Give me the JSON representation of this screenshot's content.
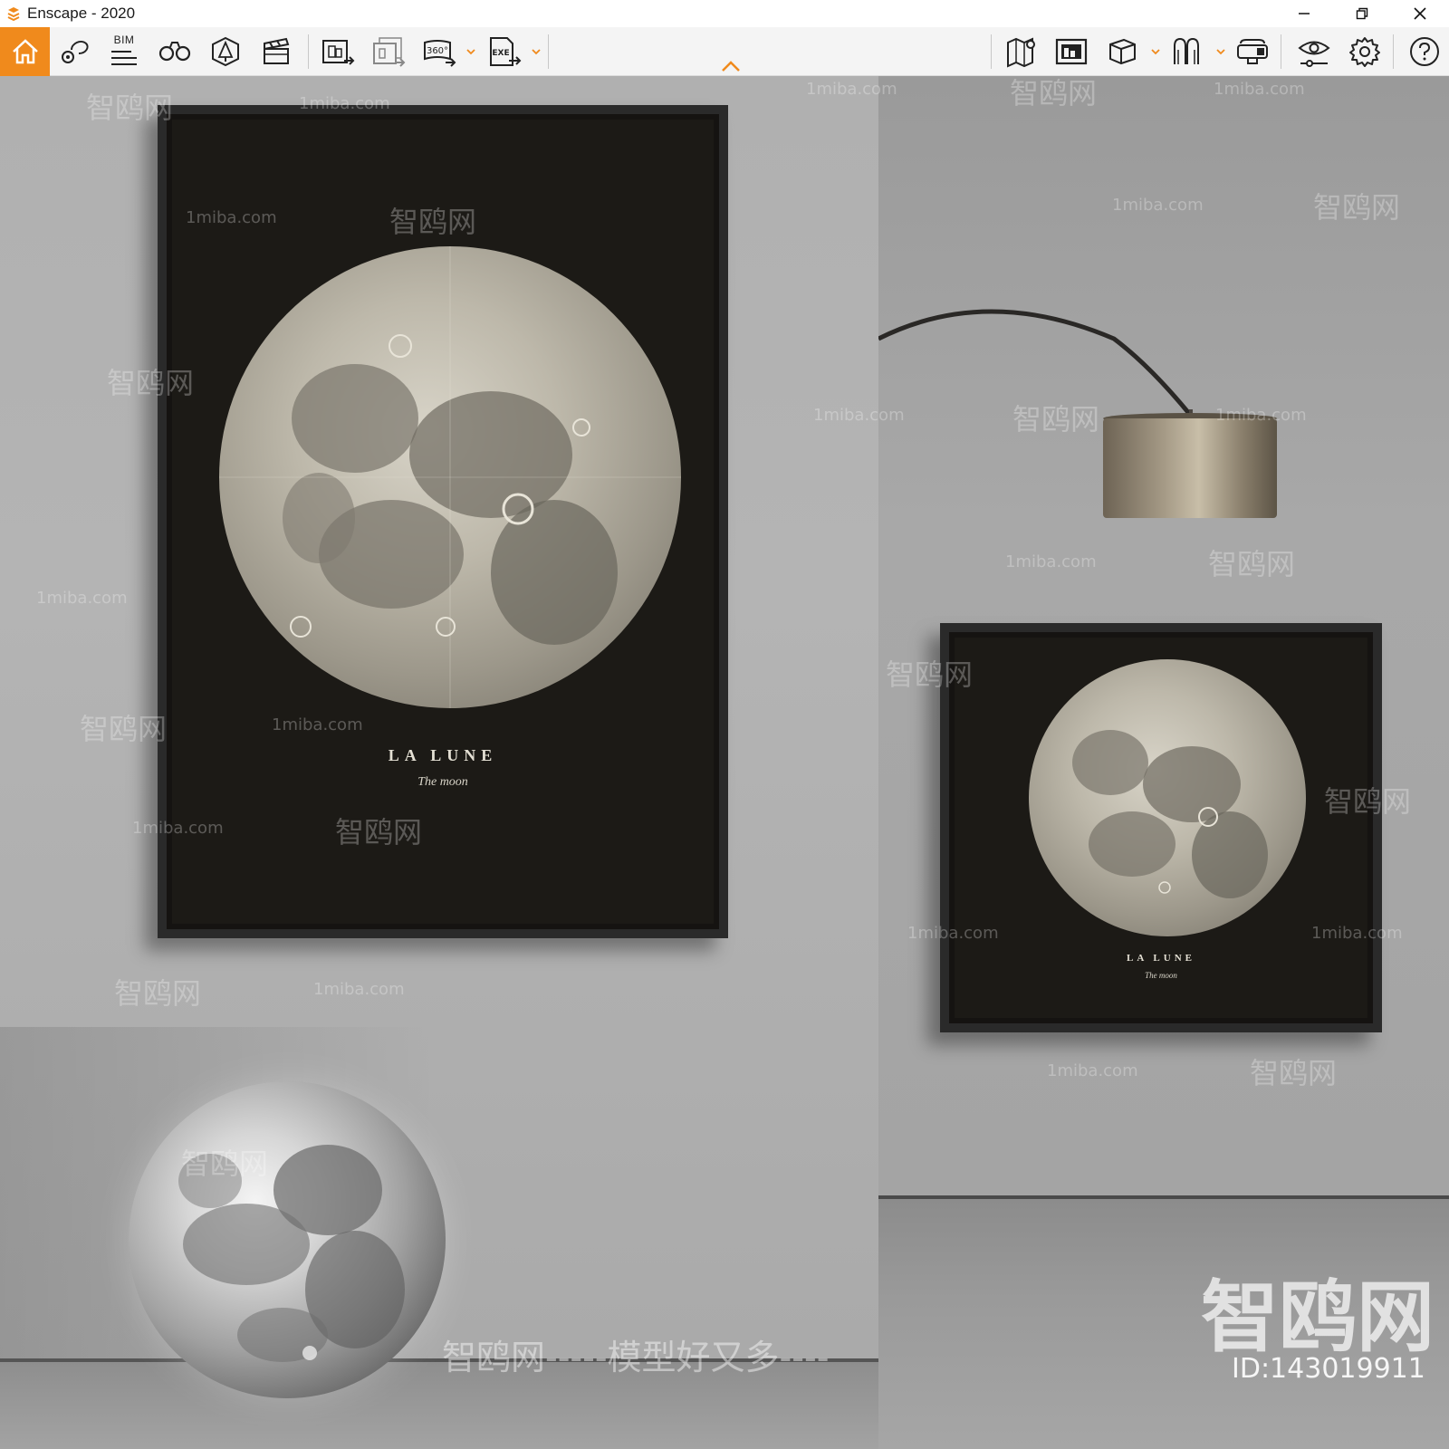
{
  "window": {
    "title": "Enscape - 2020"
  },
  "toolbar": {
    "bim_label": "BIM",
    "left_buttons": [
      "home-icon",
      "views-icon",
      "bim-icon",
      "binoculars-icon",
      "asset-library-icon",
      "video-editor-icon",
      "screenshot-export-icon",
      "batch-render-icon",
      "panorama-360-icon",
      "exe-export-icon"
    ],
    "right_buttons": [
      "map-icon",
      "screenshot-icon",
      "cube-view-icon",
      "material-editor-icon",
      "vr-headset-icon",
      "visual-settings-icon",
      "settings-gear-icon",
      "help-icon"
    ],
    "colors": {
      "accent": "#f08a1c",
      "background": "#f4f4f4"
    }
  },
  "scene": {
    "poster_large": {
      "title": "LA LUNE",
      "subtitle": "The moon"
    },
    "poster_small": {
      "title": "LA LUNE",
      "subtitle": "The moon"
    },
    "watermarks": {
      "site_cn": "智鸥网",
      "site_url": "1miba.com",
      "slogan": "智鸥网-----模型好又多----",
      "big_brand": "智鸥网",
      "id": "ID:143019911"
    }
  }
}
